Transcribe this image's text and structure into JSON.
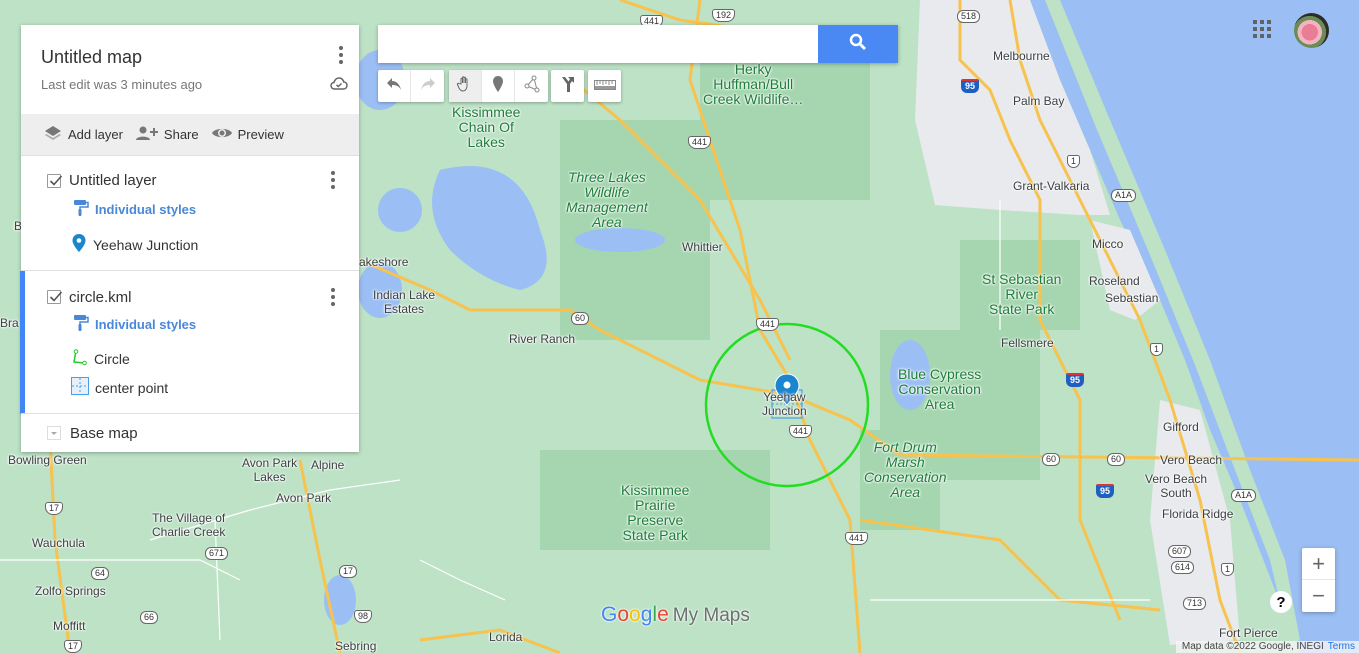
{
  "panel": {
    "title": "Untitled map",
    "last_edit": "Last edit was 3 minutes ago",
    "actions": [
      {
        "label": "Add layer",
        "icon": "layers-icon"
      },
      {
        "label": "Share",
        "icon": "add-person-icon"
      },
      {
        "label": "Preview",
        "icon": "eye-icon"
      }
    ],
    "layers": [
      {
        "name": "Untitled layer",
        "checked": true,
        "style_label": "Individual styles",
        "features": [
          {
            "label": "Yeehaw Junction",
            "icon": "blue-pin-icon"
          }
        ]
      },
      {
        "name": "circle.kml",
        "checked": true,
        "style_label": "Individual styles",
        "features": [
          {
            "label": "Circle",
            "icon": "green-line-icon"
          },
          {
            "label": "center point",
            "icon": "blue-crosshair-box-icon"
          }
        ]
      }
    ],
    "base_map_label": "Base map"
  },
  "search": {
    "value": "",
    "placeholder": ""
  },
  "toolbar": {
    "tools": [
      "undo",
      "redo",
      "select-pan",
      "add-marker",
      "draw-line",
      "add-directions",
      "measure"
    ],
    "selected": "select-pan"
  },
  "map": {
    "labels": {
      "herky": "Herky\nHuffman/Bull\nCreek Wildlife…",
      "kissimmee_chain": "Kissimmee\nChain Of\nLakes",
      "three_lakes": "Three Lakes\nWildlife\nManagement\nArea",
      "whittier": "Whittier",
      "lakeshore": "akeshore",
      "indian_lake": "Indian Lake\nEstates",
      "river_ranch": "River Ranch",
      "yeehaw": "Yeehaw\nJunction",
      "melbourne": "Melbourne",
      "palm_bay": "Palm Bay",
      "grant_valkaria": "Grant-Valkaria",
      "micco": "Micco",
      "st_sebastian": "St Sebastian\nRiver\nState Park",
      "roseland": "Roseland",
      "sebastian": "Sebastian",
      "fellsmere": "Fellsmere",
      "blue_cypress": "Blue Cypress\nConservation\nArea",
      "fort_drum": "Fort Drum\nMarsh\nConservation\nArea",
      "gifford": "Gifford",
      "vero_beach": "Vero Beach",
      "vero_beach_south": "Vero Beach\nSouth",
      "florida_ridge": "Florida Ridge",
      "fort_pierce": "Fort Pierce",
      "kissimmee_prairie": "Kissimmee\nPrairie\nPreserve\nState Park",
      "bowling_green": "Bowling Green",
      "avon_park_lakes": "Avon Park\nLakes",
      "alpine": "Alpine",
      "avon_park": "Avon Park",
      "village_charlie": "The Village of\nCharlie Creek",
      "wauchula": "Wauchula",
      "zolfo": "Zolfo Springs",
      "moffitt": "Moffitt",
      "sebring": "Sebring",
      "lorida": "Lorida",
      "bra": "Bra",
      "b": "B"
    },
    "shields": {
      "r441_top": "441",
      "r192": "192",
      "r518": "518",
      "i95_top": "95",
      "r441_mid": "441",
      "r1_a": "1",
      "a1a_a": "A1A",
      "r60_a": "60",
      "r441_b": "441",
      "r441_c": "441",
      "r1_b": "1",
      "i95_b": "95",
      "r60_b": "60",
      "r60_c": "60",
      "i95_c": "95",
      "a1a_b": "A1A",
      "r441_d": "441",
      "r607": "607",
      "r614": "614",
      "r1_c": "1",
      "r713": "713",
      "r17_a": "17",
      "r671": "671",
      "r64": "64",
      "r66": "66",
      "r17_b": "17",
      "r17_c": "17",
      "r98": "98"
    },
    "circle_color": "#22dd22",
    "marker_color": "#1a86d0"
  },
  "logo": {
    "google": [
      "G",
      "o",
      "o",
      "g",
      "l",
      "e"
    ],
    "product": "My Maps"
  },
  "zoom": {
    "in": "+",
    "out": "−"
  },
  "help": "?",
  "footer": {
    "attribution": "Map data ©2022 Google, INEGI",
    "terms": "Terms"
  }
}
